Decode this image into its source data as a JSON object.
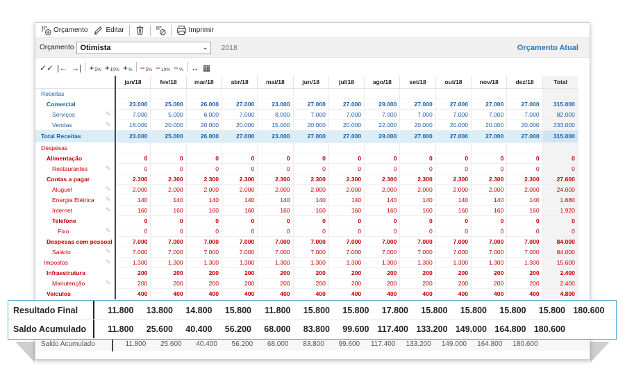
{
  "toolbar": {
    "budget_label": "Orçamento",
    "edit_label": "Editar",
    "print_label": "Imprimir"
  },
  "filter": {
    "label": "Orçamento",
    "selected": "Otimista",
    "year": "2018",
    "actual_link": "Orçamento Atual"
  },
  "tools": {
    "plus5": "5%",
    "plus10": "10%",
    "plus_pct": "%",
    "minus5": "5%",
    "minus10": "10%",
    "minus_pct": "%"
  },
  "table": {
    "months": [
      "jan/18",
      "fev/18",
      "mar/18",
      "abr/18",
      "mai/18",
      "jun/18",
      "jul/18",
      "ago/18",
      "set/18",
      "out/18",
      "nov/18",
      "dez/18"
    ],
    "total_header": "Total",
    "rows": [
      {
        "label": "Receitas",
        "style": "blue",
        "indent": 0,
        "bold": false,
        "values": null,
        "total": null,
        "edit": false
      },
      {
        "label": "Comercial",
        "style": "blue",
        "indent": 1,
        "bold": true,
        "values": [
          "23.000",
          "25.000",
          "26.000",
          "27.000",
          "23.000",
          "27.000",
          "27.000",
          "29.000",
          "27.000",
          "27.000",
          "27.000",
          "27.000"
        ],
        "total": "315.000",
        "edit": false
      },
      {
        "label": "Serviços",
        "style": "blue",
        "indent": 2,
        "bold": false,
        "values": [
          "7.000",
          "5.000",
          "6.000",
          "7.000",
          "8.000",
          "7.000",
          "7.000",
          "7.000",
          "7.000",
          "7.000",
          "7.000",
          "7.000"
        ],
        "total": "82.000",
        "edit": true
      },
      {
        "label": "Vendas",
        "style": "blue",
        "indent": 2,
        "bold": false,
        "values": [
          "16.000",
          "20.000",
          "20.000",
          "20.000",
          "15.000",
          "20.000",
          "20.000",
          "22.000",
          "20.000",
          "20.000",
          "20.000",
          "20.000"
        ],
        "total": "233.000",
        "edit": true
      },
      {
        "label": "Total Receitas",
        "style": "blue total",
        "indent": 0,
        "bold": true,
        "values": [
          "23.000",
          "25.000",
          "26.000",
          "27.000",
          "23.000",
          "27.000",
          "27.000",
          "29.000",
          "27.000",
          "27.000",
          "27.000",
          "27.000"
        ],
        "total": "315.000",
        "edit": false
      },
      {
        "label": "Despesas",
        "style": "red",
        "indent": 0,
        "bold": false,
        "values": null,
        "total": null,
        "edit": false
      },
      {
        "label": "Alimentação",
        "style": "red",
        "indent": 1,
        "bold": true,
        "values": [
          "0",
          "0",
          "0",
          "0",
          "0",
          "0",
          "0",
          "0",
          "0",
          "0",
          "0",
          "0"
        ],
        "total": "0",
        "edit": false
      },
      {
        "label": "Restaurantes",
        "style": "red",
        "indent": 2,
        "bold": false,
        "values": [
          "0",
          "0",
          "0",
          "0",
          "0",
          "0",
          "0",
          "0",
          "0",
          "0",
          "0",
          "0"
        ],
        "total": "0",
        "edit": true
      },
      {
        "label": "Contas a pagar",
        "style": "red",
        "indent": 1,
        "bold": true,
        "values": [
          "2.300",
          "2.300",
          "2.300",
          "2.300",
          "2.300",
          "2.300",
          "2.300",
          "2.300",
          "2.300",
          "2.300",
          "2.300",
          "2.300"
        ],
        "total": "27.600",
        "edit": false
      },
      {
        "label": "Aluguel",
        "style": "red",
        "indent": 2,
        "bold": false,
        "values": [
          "2.000",
          "2.000",
          "2.000",
          "2.000",
          "2.000",
          "2.000",
          "2.000",
          "2.000",
          "2.000",
          "2.000",
          "2.000",
          "2.000"
        ],
        "total": "24.000",
        "edit": true
      },
      {
        "label": "Energia Elétrica",
        "style": "red",
        "indent": 2,
        "bold": false,
        "values": [
          "140",
          "140",
          "140",
          "140",
          "140",
          "140",
          "140",
          "140",
          "140",
          "140",
          "140",
          "140"
        ],
        "total": "1.680",
        "edit": true
      },
      {
        "label": "Internet",
        "style": "red",
        "indent": 2,
        "bold": false,
        "values": [
          "160",
          "160",
          "160",
          "160",
          "160",
          "160",
          "160",
          "160",
          "160",
          "160",
          "160",
          "160"
        ],
        "total": "1.920",
        "edit": true
      },
      {
        "label": "Telefone",
        "style": "red",
        "indent": 2,
        "bold": true,
        "values": [
          "0",
          "0",
          "0",
          "0",
          "0",
          "0",
          "0",
          "0",
          "0",
          "0",
          "0",
          "0"
        ],
        "total": "0",
        "edit": false
      },
      {
        "label": "Fixo",
        "style": "red",
        "indent": 3,
        "bold": false,
        "values": [
          "0",
          "0",
          "0",
          "0",
          "0",
          "0",
          "0",
          "0",
          "0",
          "0",
          "0",
          "0"
        ],
        "total": "0",
        "edit": true
      },
      {
        "label": "Despesas com pessoal",
        "style": "red",
        "indent": 1,
        "bold": true,
        "values": [
          "7.000",
          "7.000",
          "7.000",
          "7.000",
          "7.000",
          "7.000",
          "7.000",
          "7.000",
          "7.000",
          "7.000",
          "7.000",
          "7.000"
        ],
        "total": "84.000",
        "edit": false
      },
      {
        "label": "Salário",
        "style": "red",
        "indent": 2,
        "bold": false,
        "values": [
          "7.000",
          "7.000",
          "7.000",
          "7.000",
          "7.000",
          "7.000",
          "7.000",
          "7.000",
          "7.000",
          "7.000",
          "7.000",
          "7.000"
        ],
        "total": "84.000",
        "edit": true
      },
      {
        "label": "Impostos",
        "style": "red",
        "indent": 0.5,
        "bold": false,
        "values": [
          "1.300",
          "1.300",
          "1.300",
          "1.300",
          "1.300",
          "1.300",
          "1.300",
          "1.300",
          "1.300",
          "1.300",
          "1.300",
          "1.300"
        ],
        "total": "15.600",
        "edit": true
      },
      {
        "label": "Infraestrutura",
        "style": "red",
        "indent": 1,
        "bold": true,
        "values": [
          "200",
          "200",
          "200",
          "200",
          "200",
          "200",
          "200",
          "200",
          "200",
          "200",
          "200",
          "200"
        ],
        "total": "2.400",
        "edit": false
      },
      {
        "label": "Manutenção",
        "style": "red",
        "indent": 2,
        "bold": false,
        "values": [
          "200",
          "200",
          "200",
          "200",
          "200",
          "200",
          "200",
          "200",
          "200",
          "200",
          "200",
          "200"
        ],
        "total": "2.400",
        "edit": true
      },
      {
        "label": "Veículos",
        "style": "red",
        "indent": 1,
        "bold": true,
        "values": [
          "400",
          "400",
          "400",
          "400",
          "400",
          "400",
          "400",
          "400",
          "400",
          "400",
          "400",
          "400"
        ],
        "total": "4.800",
        "edit": false
      }
    ]
  },
  "footer": {
    "saldo_label": "Saldo Acumulado",
    "saldo_values": [
      "11.800",
      "25.600",
      "40.400",
      "56.200",
      "68.000",
      "83.800",
      "99.600",
      "117.400",
      "133.200",
      "149.000",
      "164.800",
      "180.600"
    ]
  },
  "overlay": {
    "resultado_label": "Resultado Final",
    "resultado_values": [
      "11.800",
      "13.800",
      "14.800",
      "15.800",
      "11.800",
      "15.800",
      "15.800",
      "17.800",
      "15.800",
      "15.800",
      "15.800",
      "15.800",
      "180.600"
    ],
    "saldo_label": "Saldo Acumulado",
    "saldo_values": [
      "11.800",
      "25.600",
      "40.400",
      "56.200",
      "68.000",
      "83.800",
      "99.600",
      "117.400",
      "133.200",
      "149.000",
      "164.800",
      "180.600"
    ]
  },
  "colors": {
    "revenue": "#1f5fa8",
    "expense": "#c00000",
    "total_row_bg": "#dbeef7",
    "highlight_border": "#5aaed1",
    "link": "#2e75b6"
  },
  "icons": [
    "budget-icon",
    "edit-icon",
    "delete-icon",
    "clear-icon",
    "print-icon",
    "check-all-icon",
    "first-icon",
    "last-icon",
    "add-percent-icon",
    "subtract-percent-icon",
    "expand-icon",
    "grid-icon",
    "pencil-icon"
  ]
}
